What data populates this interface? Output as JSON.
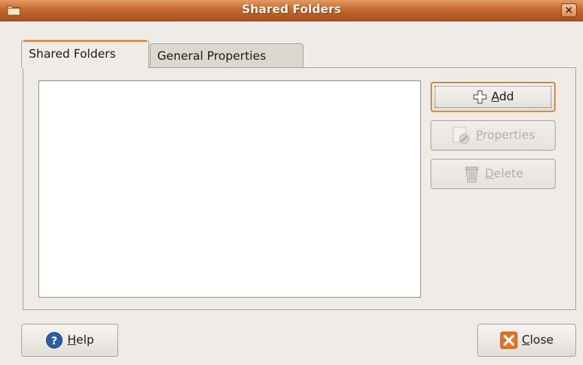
{
  "window": {
    "title": "Shared Folders",
    "close_glyph": "✕"
  },
  "tabs": [
    {
      "label": "Shared Folders",
      "active": true
    },
    {
      "label": "General Properties",
      "active": false
    }
  ],
  "list": {
    "items": []
  },
  "buttons": {
    "add": {
      "mnemonic": "A",
      "rest": "dd",
      "icon": "plus-icon",
      "enabled": true
    },
    "properties": {
      "mnemonic": "P",
      "rest": "roperties",
      "icon": "properties-icon",
      "enabled": false
    },
    "delete": {
      "mnemonic": "D",
      "rest": "elete",
      "icon": "trash-icon",
      "enabled": false
    },
    "help": {
      "mnemonic": "H",
      "rest": "elp",
      "icon": "help-icon"
    },
    "close": {
      "mnemonic": "C",
      "rest": "lose",
      "icon": "close-icon"
    }
  },
  "colors": {
    "titlebar": "#c4692f",
    "focus_accent": "#d38445",
    "help_icon": "#2a5fa8",
    "close_icon": "#e8741f"
  }
}
